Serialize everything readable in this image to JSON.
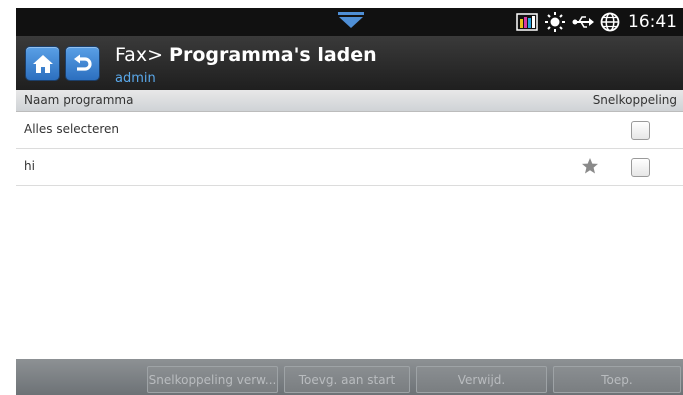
{
  "status_bar": {
    "time": "16:41",
    "icons": [
      "pull-down-tab-icon",
      "toner-level-icon",
      "brightness-icon",
      "usb-icon",
      "globe-icon"
    ]
  },
  "header": {
    "title_prefix": "Fax> ",
    "title": "Programma's laden",
    "user": "admin"
  },
  "table": {
    "col_name": "Naam programma",
    "col_shortcut": "Snelkoppeling",
    "rows": [
      {
        "label": "Alles selecteren",
        "starred": false,
        "checked": false
      },
      {
        "label": "hi",
        "starred": true,
        "checked": false
      }
    ]
  },
  "bottom_bar": {
    "buttons": [
      "Snelkoppeling verw...",
      "Toevg. aan start",
      "Verwijd.",
      "Toep."
    ]
  },
  "colors": {
    "accent": "#2c6fbf",
    "subtitle": "#5aa8ea"
  }
}
